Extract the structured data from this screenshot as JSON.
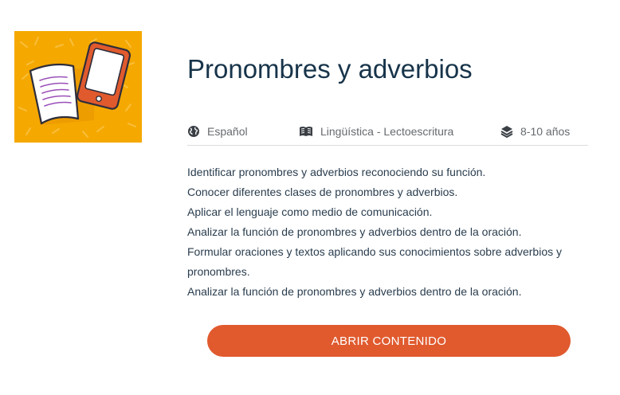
{
  "resource": {
    "title": "Pronombres y adverbios",
    "thumbnail_icon": "book-tablet-icon",
    "thumbnail_color": "#f5a800"
  },
  "meta": {
    "language": {
      "icon": "globe-icon",
      "label": "Español"
    },
    "area": {
      "icon": "open-book-icon",
      "label": "Lingüística - Lectoescritura"
    },
    "age": {
      "icon": "layers-icon",
      "label": "8-10 años"
    }
  },
  "objectives": [
    "Identificar pronombres y adverbios reconociendo su función.",
    "Conocer diferentes clases de pronombres y adverbios.",
    "Aplicar el lenguaje como medio de comunicación.",
    "Analizar la función de pronombres y adverbios dentro de la oración.",
    "Formular oraciones y textos aplicando sus conocimientos sobre adverbios y pronombres.",
    "Analizar la función de pronombres y adverbios dentro de la oración."
  ],
  "actions": {
    "open_label": "ABRIR CONTENIDO",
    "accent_color": "#e05a2e"
  }
}
